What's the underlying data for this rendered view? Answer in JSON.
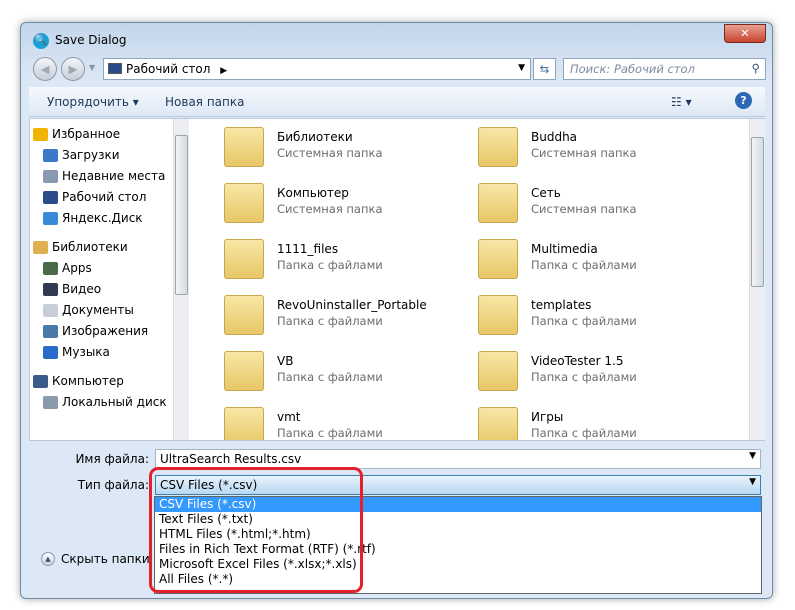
{
  "window": {
    "title": "Save Dialog",
    "close_label": "✕"
  },
  "address": {
    "path": "Рабочий стол",
    "search_placeholder": "Поиск: Рабочий стол"
  },
  "toolbar": {
    "organize": "Упорядочить ▾",
    "new_folder": "Новая папка",
    "help": "?"
  },
  "sidebar": {
    "items": [
      {
        "label": "Избранное",
        "color": "#f0b400",
        "indent": 0
      },
      {
        "label": "Загрузки",
        "color": "#3c78c8",
        "indent": 1
      },
      {
        "label": "Недавние места",
        "color": "#8a9ab0",
        "indent": 1
      },
      {
        "label": "Рабочий стол",
        "color": "#2a4c8a",
        "indent": 1
      },
      {
        "label": "Яндекс.Диск",
        "color": "#3a8ad8",
        "indent": 1
      },
      {
        "label": "Библиотеки",
        "color": "#e0b050",
        "indent": 0,
        "gap": true
      },
      {
        "label": "Apps",
        "color": "#4a6a4a",
        "indent": 1
      },
      {
        "label": "Видео",
        "color": "#303a50",
        "indent": 1
      },
      {
        "label": "Документы",
        "color": "#c8ced8",
        "indent": 1
      },
      {
        "label": "Изображения",
        "color": "#4a7aa8",
        "indent": 1
      },
      {
        "label": "Музыка",
        "color": "#2a6ac8",
        "indent": 1
      },
      {
        "label": "Компьютер",
        "color": "#3a5a8a",
        "indent": 0,
        "gap": true
      },
      {
        "label": "Локальный диск",
        "color": "#8a9aaa",
        "indent": 1
      }
    ]
  },
  "files": [
    {
      "name": "Библиотеки",
      "type": "Системная папка"
    },
    {
      "name": "Buddha",
      "type": "Системная папка"
    },
    {
      "name": "Компьютер",
      "type": "Системная папка"
    },
    {
      "name": "Сеть",
      "type": "Системная папка"
    },
    {
      "name": "1111_files",
      "type": "Папка с файлами"
    },
    {
      "name": "Multimedia",
      "type": "Папка с файлами"
    },
    {
      "name": "RevoUninstaller_Portable",
      "type": "Папка с файлами"
    },
    {
      "name": "templates",
      "type": "Папка с файлами"
    },
    {
      "name": "VB",
      "type": "Папка с файлами"
    },
    {
      "name": "VideoTester 1.5",
      "type": "Папка с файлами"
    },
    {
      "name": "vmt",
      "type": "Папка с файлами"
    },
    {
      "name": "Игры",
      "type": "Папка с файлами"
    }
  ],
  "form": {
    "filename_label": "Имя файла:",
    "filename_value": "UltraSearch Results.csv",
    "filetype_label": "Тип файла:",
    "filetype_value": "CSV Files (*.csv)"
  },
  "filetype_options": [
    "CSV Files (*.csv)",
    "Text Files (*.txt)",
    "HTML Files (*.html;*.htm)",
    "Files in Rich Text Format (RTF) (*.rtf)",
    "Microsoft Excel Files (*.xlsx;*.xls)",
    "All Files (*.*)"
  ],
  "selected_option": 0,
  "hide_folders": "Скрыть папки",
  "highlight_color": "#e3202b"
}
